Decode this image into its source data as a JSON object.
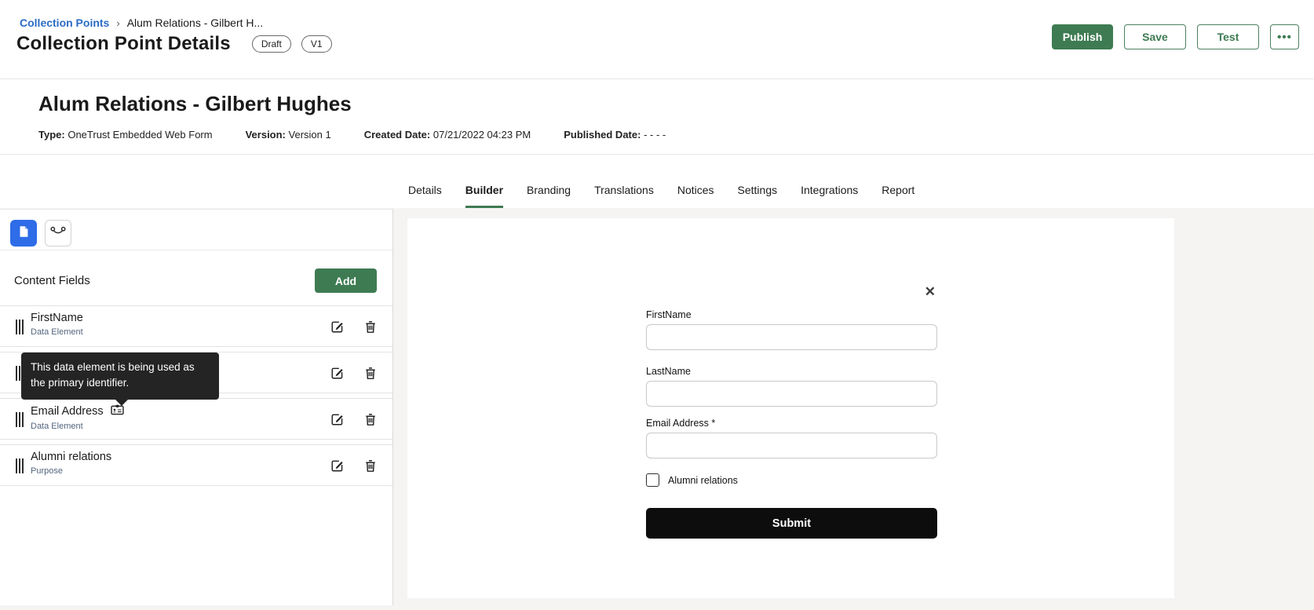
{
  "breadcrumb": {
    "root": "Collection Points",
    "separator": "›",
    "current": "Alum Relations - Gilbert H..."
  },
  "header": {
    "title": "Collection Point Details",
    "badges": {
      "status": "Draft",
      "version": "V1"
    },
    "actions": {
      "publish": "Publish",
      "save": "Save",
      "test": "Test",
      "more": "•••"
    }
  },
  "info": {
    "title": "Alum Relations - Gilbert Hughes",
    "meta": [
      {
        "label": "Type:",
        "value": "OneTrust Embedded Web Form"
      },
      {
        "label": "Version:",
        "value": "Version 1"
      },
      {
        "label": "Created Date:",
        "value": "07/21/2022 04:23 PM"
      },
      {
        "label": "Published Date:",
        "value": "- - - -"
      }
    ]
  },
  "tabs": {
    "active": "Builder",
    "items": [
      "Details",
      "Builder",
      "Branding",
      "Translations",
      "Notices",
      "Settings",
      "Integrations",
      "Report"
    ]
  },
  "builder": {
    "panel_title": "Content Fields",
    "add_label": "Add",
    "tooltip_text": "This data element is being used as the primary identifier.",
    "fields": [
      {
        "title": "FirstName",
        "subtitle": "Data Element"
      },
      {
        "title": "",
        "subtitle": ""
      },
      {
        "title": "Email Address",
        "subtitle": "Data Element"
      },
      {
        "title": "Alumni relations",
        "subtitle": "Purpose"
      }
    ],
    "icons": {
      "left_toggle": "form-page-icon",
      "right_toggle": "logic-branch-icon",
      "row_badge": "primary-identifier-badge-icon"
    }
  },
  "preview": {
    "close_label": "✕",
    "fields": [
      {
        "label": "FirstName",
        "value": ""
      },
      {
        "label": "LastName",
        "value": ""
      },
      {
        "label": "Email Address *",
        "value": ""
      }
    ],
    "checkbox": {
      "label": "Alumni relations",
      "checked": false
    },
    "submit_label": "Submit"
  },
  "colors": {
    "accent_green": "#3e7b52",
    "link_blue": "#2b6cc4",
    "tool_blue": "#2e6ce8",
    "tooltip_bg": "#242424",
    "submit_bg": "#0d0d0d",
    "subtitle_slate": "#53657d"
  }
}
